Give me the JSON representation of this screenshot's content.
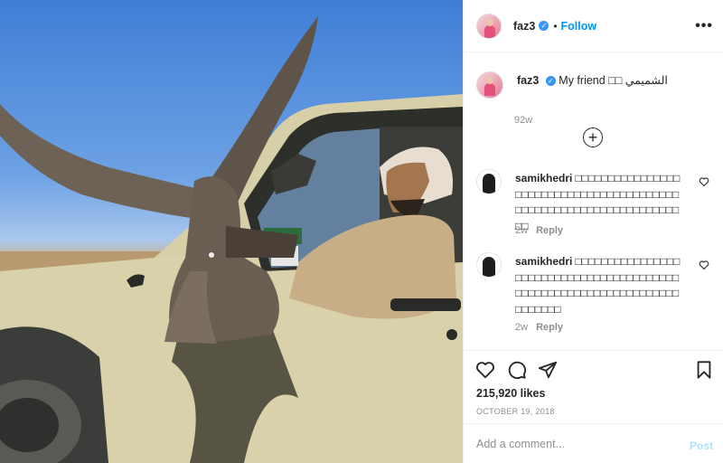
{
  "header": {
    "username": "faz3",
    "separator": "•",
    "follow_label": "Follow",
    "more_label": "•••"
  },
  "caption": {
    "username": "faz3",
    "text": "My friend",
    "emoji": "□□",
    "arabic": "الشميمي",
    "time": "92w"
  },
  "comments": [
    {
      "username": "samikhedri",
      "text": "□□□□□□□□□□□□□□□□□□□□□□□□□□□□□□□□□□□□□□□□□□□□□□□□□□□□□□□□□□□□□□□□□□□□",
      "time": "2w",
      "reply_label": "Reply"
    },
    {
      "username": "samikhedri",
      "text": "□□□□□□□□□□□□□□□□□□□□□□□□□□□□□□□□□□□□□□□□□□□□□□□□□□□□□□□□□□□□□□□□□□□□□□□□□",
      "time": "2w",
      "reply_label": "Reply"
    }
  ],
  "actions": {
    "likes": "215,920 likes",
    "date": "OCTOBER 19, 2018"
  },
  "add_comment": {
    "placeholder": "Add a comment...",
    "post_label": "Post"
  },
  "icons": {
    "like": "heart-icon",
    "comment": "comment-icon",
    "share": "share-icon",
    "save": "bookmark-icon",
    "verified": "verified-badge-icon",
    "load_more": "plus-circle-icon"
  },
  "colors": {
    "accent": "#0095f6",
    "verified": "#3897f0",
    "muted": "#8e8e8e",
    "post_disabled": "#b2dffc"
  }
}
